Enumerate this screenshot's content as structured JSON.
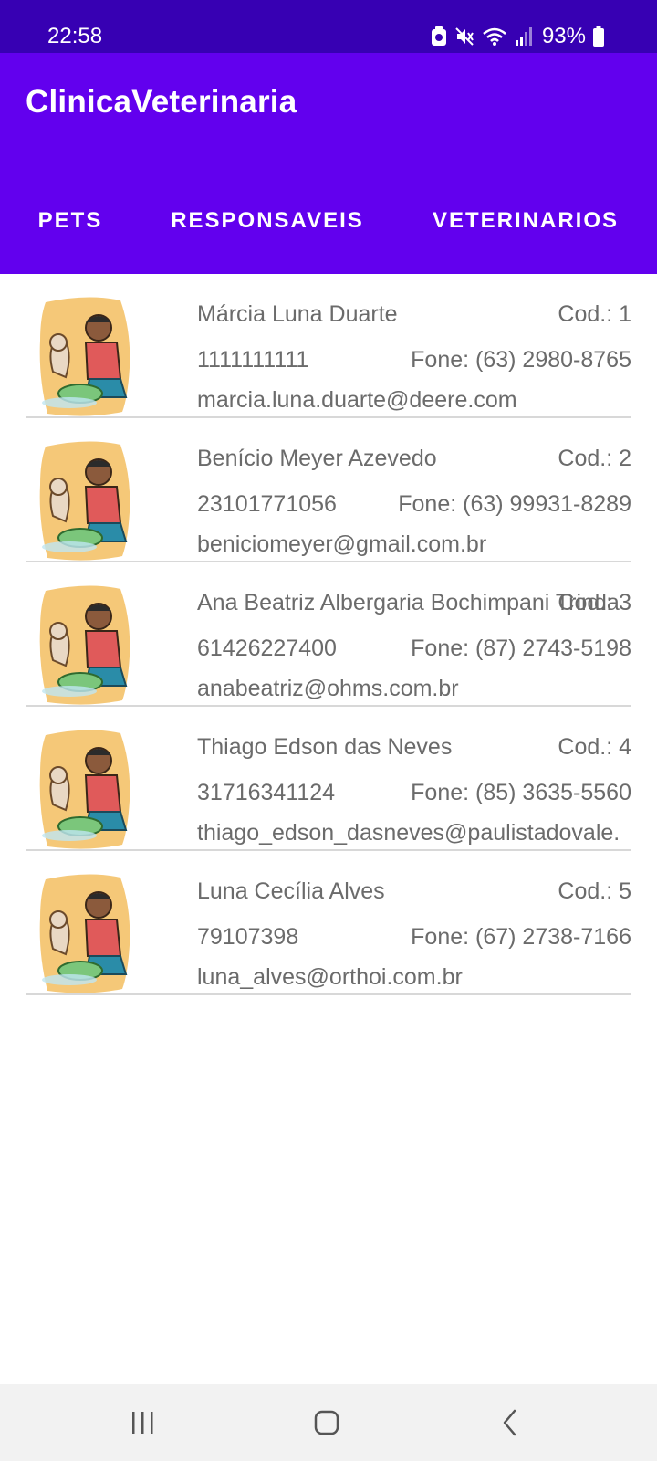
{
  "status_bar": {
    "time": "22:58",
    "battery_percent": "93%",
    "icons": [
      "android-notification-icon",
      "mute-icon",
      "wifi-icon",
      "signal-icon",
      "battery-icon"
    ]
  },
  "app": {
    "title": "ClinicaVeterinaria",
    "colors": {
      "primary": "#6200ee",
      "primary_dark": "#3700b3",
      "text_secondary": "#6b6b6b"
    }
  },
  "tabs": [
    {
      "label": "PETS"
    },
    {
      "label": "RESPONSAVEIS"
    },
    {
      "label": "VETERINARIOS"
    }
  ],
  "responsaveis": [
    {
      "name": "Márcia Luna Duarte",
      "cod": "Cod.: 1",
      "cpf": "1111111111",
      "phone": "Fone: (63) 2980-8765",
      "email": "marcia.luna.duarte@deere.com"
    },
    {
      "name": "Benício Meyer Azevedo",
      "cod": "Cod.: 2",
      "cpf": "23101771056",
      "phone": "Fone: (63) 99931-8289",
      "email": "beniciomeyer@gmail.com.br"
    },
    {
      "name": "Ana Beatriz Albergaria Bochimpani Trinda",
      "cod": "Cod.: 3",
      "cpf": "61426227400",
      "phone": "Fone: (87) 2743-5198",
      "email": "anabeatriz@ohms.com.br"
    },
    {
      "name": "Thiago Edson das Neves",
      "cod": "Cod.: 4",
      "cpf": "31716341124",
      "phone": "Fone: (85) 3635-5560",
      "email": "thiago_edson_dasneves@paulistadovale."
    },
    {
      "name": "Luna Cecília Alves",
      "cod": "Cod.: 5",
      "cpf": "79107398",
      "phone": "Fone: (67) 2738-7166",
      "email": "luna_alves@orthoi.com.br"
    }
  ],
  "nav_bar": {
    "icons": [
      "recent-apps-icon",
      "home-icon",
      "back-icon"
    ]
  }
}
